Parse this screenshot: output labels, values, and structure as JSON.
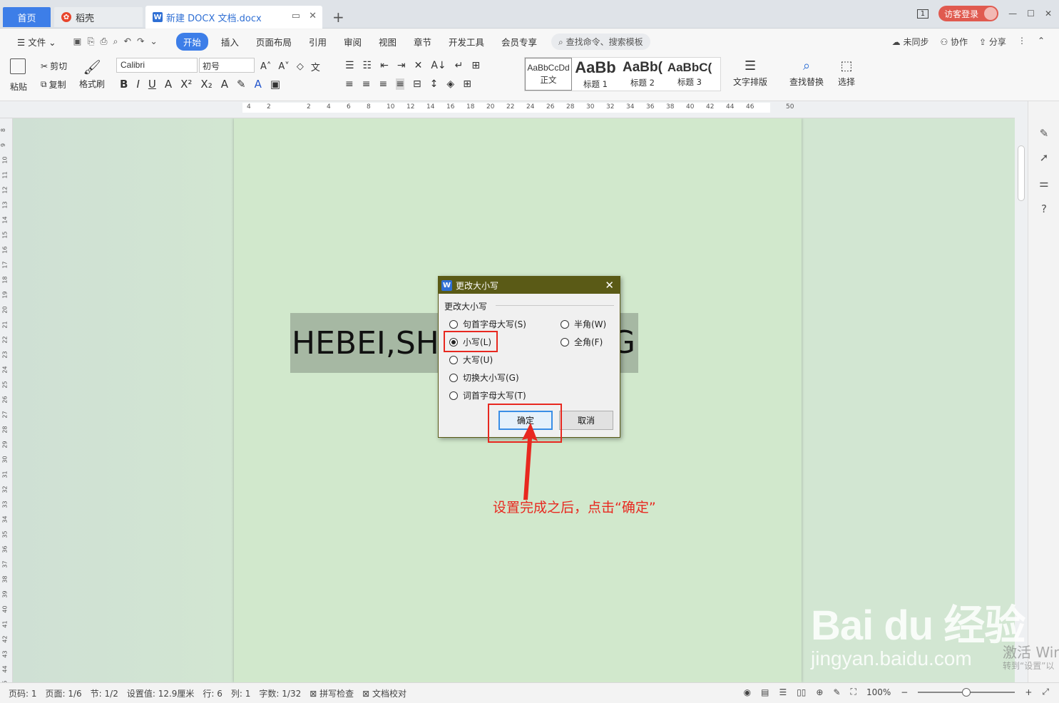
{
  "tabs": {
    "home": "首页",
    "daoke": "稻壳",
    "doc": "新建 DOCX 文档.docx",
    "new_tab": "+"
  },
  "titlebar": {
    "page_badge": "1",
    "visitor": "访客登录",
    "min": "—",
    "max": "☐",
    "close": "✕"
  },
  "menu": {
    "file": "文件",
    "items": [
      "开始",
      "插入",
      "页面布局",
      "引用",
      "审阅",
      "视图",
      "章节",
      "开发工具",
      "会员专享"
    ],
    "search": "查找命令、搜索模板",
    "sync": "未同步",
    "collab": "协作",
    "share": "分享"
  },
  "ribbon": {
    "paste": "粘贴",
    "cut": "剪切",
    "copy": "复制",
    "format_painter": "格式刷",
    "font": "Calibri",
    "size": "初号",
    "styles": [
      {
        "preview": "AaBbCcDd",
        "name": "正文"
      },
      {
        "preview": "AaBb",
        "name": "标题 1"
      },
      {
        "preview": "AaBb(",
        "name": "标题 2"
      },
      {
        "preview": "AaBbC(",
        "name": "标题 3"
      }
    ],
    "text_layout": "文字排版",
    "find_replace": "查找替换",
    "select": "选择"
  },
  "ruler_ticks": [
    "4",
    "2",
    "",
    "2",
    "4",
    "6",
    "8",
    "10",
    "12",
    "14",
    "16",
    "18",
    "20",
    "22",
    "24",
    "26",
    "28",
    "30",
    "32",
    "34",
    "36",
    "38",
    "40",
    "42",
    "44",
    "46",
    "",
    "50"
  ],
  "ruler_v": [
    "8",
    "9",
    "10",
    "11",
    "12",
    "13",
    "14",
    "15",
    "16",
    "17",
    "18",
    "19",
    "20",
    "21",
    "22",
    "23",
    "24",
    "25",
    "26",
    "27",
    "28",
    "29",
    "30",
    "31",
    "32",
    "33",
    "34",
    "35",
    "36",
    "37",
    "38",
    "39",
    "40",
    "41",
    "42",
    "43",
    "44",
    "45"
  ],
  "document": {
    "selected_text": "HEBEI,SH",
    "selected_text_tail": "G"
  },
  "dialog": {
    "title": "更改大小写",
    "group": "更改大小写",
    "options_left": [
      "句首字母大写(S)",
      "小写(L)",
      "大写(U)",
      "切换大小写(G)",
      "词首字母大写(T)"
    ],
    "options_right": [
      "半角(W)",
      "全角(F)"
    ],
    "checked": "小写(L)",
    "ok": "确定",
    "cancel": "取消"
  },
  "annotation": "设置完成之后，点击“确定”",
  "statusbar": {
    "page_num": "页码: 1",
    "pages": "页面: 1/6",
    "section": "节: 1/2",
    "setting": "设置值: 12.9厘米",
    "row": "行: 6",
    "col": "列: 1",
    "words": "字数: 1/32",
    "spell": "拼写检查",
    "proof": "文档校对",
    "zoom": "100%"
  },
  "watermark": {
    "brand": "Bai du 经验",
    "url": "jingyan.baidu.com",
    "activate": "激活 Win",
    "activate_sub": "转到“设置”以"
  },
  "colors": {
    "accent": "#3d7ee8",
    "dialog_title": "#5a5a16",
    "highlight": "#e8281f",
    "page_bg": "#d1e8cc"
  }
}
